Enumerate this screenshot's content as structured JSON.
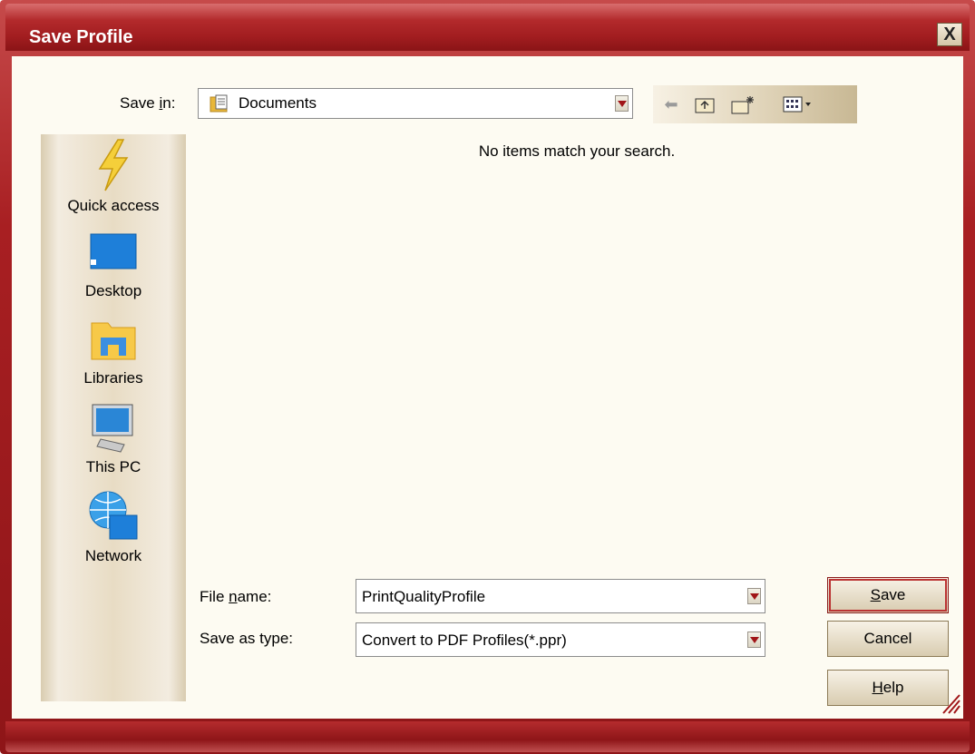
{
  "window": {
    "title": "Save Profile",
    "close_label": "X"
  },
  "location": {
    "label_pre": "Save ",
    "label_ul": "i",
    "label_post": "n:",
    "value": "Documents"
  },
  "content": {
    "empty_message": "No items match your search."
  },
  "sidebar": {
    "items": [
      {
        "label": "Quick access",
        "icon": "lightning-icon"
      },
      {
        "label": "Desktop",
        "icon": "desktop-icon"
      },
      {
        "label": "Libraries",
        "icon": "libraries-icon"
      },
      {
        "label": "This PC",
        "icon": "computer-icon"
      },
      {
        "label": "Network",
        "icon": "network-icon"
      }
    ]
  },
  "form": {
    "filename_label_pre": "File ",
    "filename_label_ul": "n",
    "filename_label_post": "ame:",
    "filename_value": "PrintQualityProfile",
    "type_label": "Save as type:",
    "type_value": "Convert to PDF Profiles(*.ppr)"
  },
  "buttons": {
    "save_ul": "S",
    "save_rest": "ave",
    "cancel": "Cancel",
    "help_ul": "H",
    "help_rest": "elp"
  },
  "colors": {
    "accent": "#a81f22",
    "panel": "#fdfbf2",
    "button": "#e8dcc4"
  }
}
